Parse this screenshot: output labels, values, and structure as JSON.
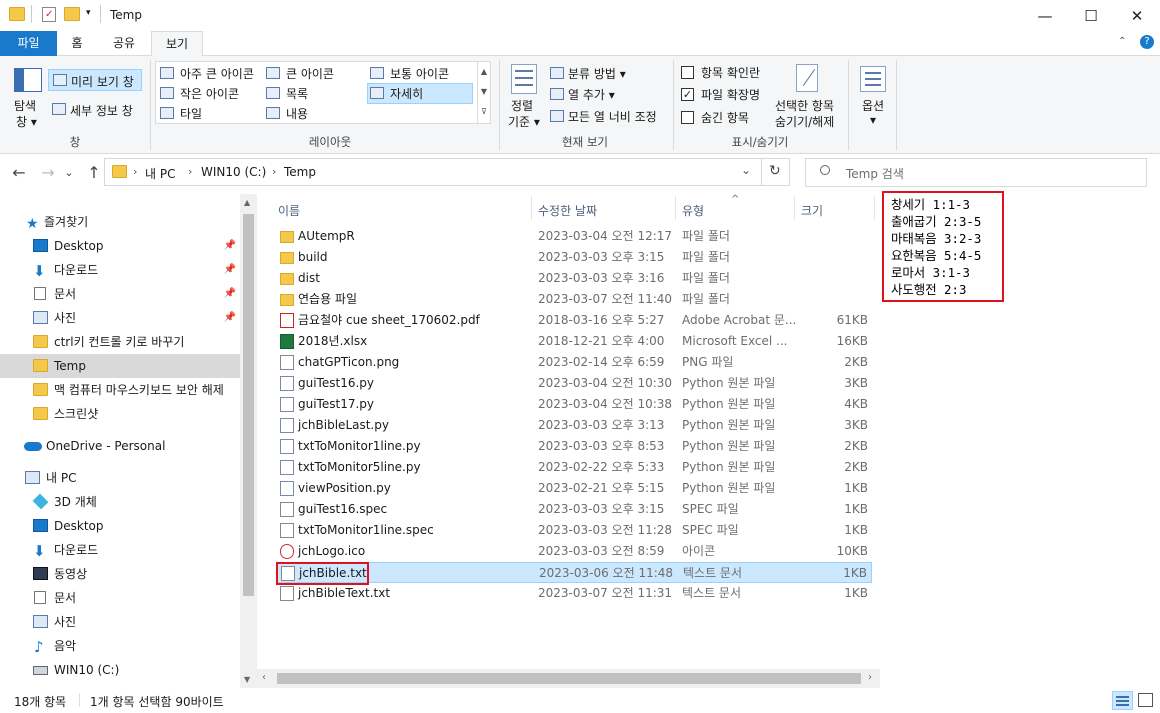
{
  "window": {
    "title": "Temp",
    "minimize_glyph": "—",
    "maximize_glyph": "☐",
    "close_glyph": "✕"
  },
  "ribbon_tabs": [
    "파일",
    "홈",
    "공유",
    "보기"
  ],
  "ribbon": {
    "pane_group": {
      "nav_pane_label": "탐색\n창",
      "nav_pane_l1": "탐색",
      "nav_pane_l2": "창 ▾",
      "preview": "미리 보기 창",
      "details": "세부 정보 창",
      "label": "창"
    },
    "layout_group": {
      "items": [
        "아주 큰 아이콘",
        "큰 아이콘",
        "보통 아이콘",
        "작은 아이콘",
        "목록",
        "자세히",
        "타일",
        "내용"
      ],
      "label": "레이아웃"
    },
    "current_view": {
      "sort_l1": "정렬",
      "sort_l2": "기준 ▾",
      "group_by": "분류 방법 ▾",
      "add_column": "열 추가 ▾",
      "fit_columns": "모든 열 너비 조정",
      "label": "현재 보기"
    },
    "show_hide": {
      "item_checkboxes": "항목 확인란",
      "extensions": "파일 확장명",
      "hidden_items": "숨긴 항목",
      "extensions_checked": true,
      "hide_selected_l1": "선택한 항목",
      "hide_selected_l2": "숨기기/해제",
      "label": "표시/숨기기"
    },
    "options": {
      "label": "옵션",
      "caret": "▾"
    }
  },
  "address": {
    "back": "←",
    "forward": "→",
    "recent": "⌄",
    "up": "↑",
    "crumbs": [
      "내 PC",
      "WIN10 (C:)",
      "Temp"
    ],
    "sep": "›",
    "dropdown": "⌄",
    "refresh": "↻",
    "search_placeholder": "Temp 검색"
  },
  "nav_pane": {
    "quick_access": "즐겨찾기",
    "quick_items": [
      "Desktop",
      "다운로드",
      "문서",
      "사진",
      "ctrl키 컨트롤 키로 바꾸기",
      "Temp",
      "맥 컴퓨터 마우스키보드 보안 해제",
      "스크린샷"
    ],
    "onedrive": "OneDrive - Personal",
    "this_pc": "내 PC",
    "pc_items": [
      "3D 개체",
      "Desktop",
      "다운로드",
      "동영상",
      "문서",
      "사진",
      "음악",
      "WIN10 (C:)"
    ]
  },
  "columns": {
    "name": "이름",
    "date": "수정한 날짜",
    "type": "유형",
    "size": "크기",
    "sort_arrow": "^"
  },
  "files": [
    {
      "name": "AUtempR",
      "date": "2023-03-04 오전 12:17",
      "type": "파일 폴더",
      "size": "",
      "icon": "folder-icon"
    },
    {
      "name": "build",
      "date": "2023-03-03 오후 3:15",
      "type": "파일 폴더",
      "size": "",
      "icon": "folder-icon"
    },
    {
      "name": "dist",
      "date": "2023-03-03 오후 3:16",
      "type": "파일 폴더",
      "size": "",
      "icon": "folder-icon"
    },
    {
      "name": "연습용 파일",
      "date": "2023-03-07 오전 11:40",
      "type": "파일 폴더",
      "size": "",
      "icon": "folder-icon"
    },
    {
      "name": "금요철야 cue sheet_170602.pdf",
      "date": "2018-03-16 오후 5:27",
      "type": "Adobe Acrobat 문...",
      "size": "61KB",
      "icon": "pdf-icon"
    },
    {
      "name": "2018년.xlsx",
      "date": "2018-12-21 오후 4:00",
      "type": "Microsoft Excel ...",
      "size": "16KB",
      "icon": "excel-icon"
    },
    {
      "name": "chatGPTicon.png",
      "date": "2023-02-14 오후 6:59",
      "type": "PNG 파일",
      "size": "2KB",
      "icon": "image-icon"
    },
    {
      "name": "guiTest16.py",
      "date": "2023-03-04 오전 10:30",
      "type": "Python 원본 파일",
      "size": "3KB",
      "icon": "python-icon"
    },
    {
      "name": "guiTest17.py",
      "date": "2023-03-04 오전 10:38",
      "type": "Python 원본 파일",
      "size": "4KB",
      "icon": "python-icon"
    },
    {
      "name": "jchBibleLast.py",
      "date": "2023-03-03 오후 3:13",
      "type": "Python 원본 파일",
      "size": "3KB",
      "icon": "python-icon"
    },
    {
      "name": "txtToMonitor1line.py",
      "date": "2023-03-03 오후 8:53",
      "type": "Python 원본 파일",
      "size": "2KB",
      "icon": "python-icon"
    },
    {
      "name": "txtToMonitor5line.py",
      "date": "2023-02-22 오후 5:33",
      "type": "Python 원본 파일",
      "size": "2KB",
      "icon": "python-icon"
    },
    {
      "name": "viewPosition.py",
      "date": "2023-02-21 오후 5:15",
      "type": "Python 원본 파일",
      "size": "1KB",
      "icon": "python-icon"
    },
    {
      "name": "guiTest16.spec",
      "date": "2023-03-03 오후 3:15",
      "type": "SPEC 파일",
      "size": "1KB",
      "icon": "file-icon"
    },
    {
      "name": "txtToMonitor1line.spec",
      "date": "2023-03-03 오전 11:28",
      "type": "SPEC 파일",
      "size": "1KB",
      "icon": "file-icon"
    },
    {
      "name": "jchLogo.ico",
      "date": "2023-03-03 오전 8:59",
      "type": "아이콘",
      "size": "10KB",
      "icon": "logo-icon"
    },
    {
      "name": "jchBible.txt",
      "date": "2023-03-06 오전 11:48",
      "type": "텍스트 문서",
      "size": "1KB",
      "icon": "text-file-icon",
      "selected": true
    },
    {
      "name": "jchBibleText.txt",
      "date": "2023-03-07 오전 11:31",
      "type": "텍스트 문서",
      "size": "1KB",
      "icon": "text-file-icon"
    }
  ],
  "status": {
    "count": "18개 항목",
    "selection": "1개 항목 선택함 90바이트"
  },
  "annotation_lines": [
    "창세기 1:1-3",
    "출애굽기 2:3-5",
    "마태복음 3:2-3",
    "요한복음 5:4-5",
    "로마서 3:1-3",
    "사도행전 2:3"
  ],
  "colors": {
    "accent": "#1979ca",
    "selection": "#cce8ff",
    "highlight_border": "#e0101d",
    "folder": "#f5c84c"
  }
}
